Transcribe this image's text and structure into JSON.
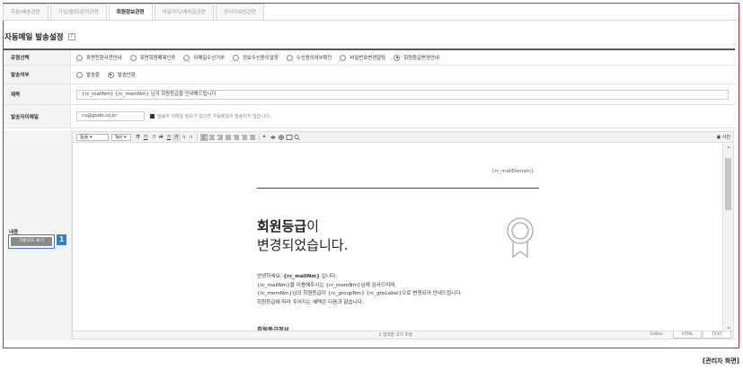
{
  "tabs": [
    {
      "label": "주문/배송관련",
      "active": false
    },
    {
      "label": "가입/탈퇴/문의관련",
      "active": false
    },
    {
      "label": "회원정보관련",
      "active": true
    },
    {
      "label": "마일리지/예치금관련",
      "active": false
    },
    {
      "label": "관리자보안관련",
      "active": false
    }
  ],
  "page": {
    "title": "자동메일 발송설정",
    "help": "?"
  },
  "type_row": {
    "label": "유형선택",
    "options": [
      "휴면전환사전안내",
      "휴면회원해제인증",
      "이메일수신거부",
      "정보수신동의설정",
      "수신동의여부확인",
      "비밀번호변경알림",
      "회원등급변경안내"
    ],
    "selected": "회원등급변경안내"
  },
  "send_row": {
    "label": "발송여부",
    "options": [
      "발송함",
      "발송안함"
    ],
    "selected": "발송안함"
  },
  "subject_row": {
    "label": "제목",
    "value": "{rc_mallNm} {rc_memNm} 님의 회원등급을 안내해드립니다."
  },
  "sender_row": {
    "label": "발송자이메일",
    "value": "cs@godo.co.kr",
    "note": "발송자 이메일 정보가 없으면 자동메일이 발송되지 않습니다."
  },
  "content_row": {
    "label": "내용",
    "replace_button": "치환코드 보기",
    "marker": "1"
  },
  "editor": {
    "toolbar": {
      "font": "돋움",
      "size": "9pt",
      "buttons": [
        "가",
        "가",
        "가",
        "가",
        "가",
        "가",
        "가",
        "가"
      ]
    },
    "view_source": "사진",
    "domain_var": "{rc_mallDomain}",
    "heading_bold": "회원등급",
    "heading_rest": "이",
    "heading_line2": "변경되었습니다.",
    "greeting_prefix": "안녕하세요.",
    "greeting_mall": "{rc_mallNm}",
    "greeting_suffix": "입니다.",
    "lines": [
      "{rc_mallNm}을 이용해주시는 {rc_memNm}님께 감사드리며,",
      "{rc_memNm}님의 회원등급이 {rc_groupNm} {rc_grpLabel}으로 변경되어 안내드립니다.",
      "회원등급에 따라 주어지는 혜택은 다음과 같습니다."
    ],
    "section_title": "회원등급정보",
    "resize_label": "⇕ 입력창 크기 조절",
    "modes": [
      "Editor",
      "HTML",
      "TEXT"
    ],
    "active_mode": "Editor"
  },
  "caption": "[관리자 화면]",
  "colors": {
    "frame": "#e0202b",
    "marker": "#2f7fd6",
    "button_border": "#3b7bd8"
  }
}
